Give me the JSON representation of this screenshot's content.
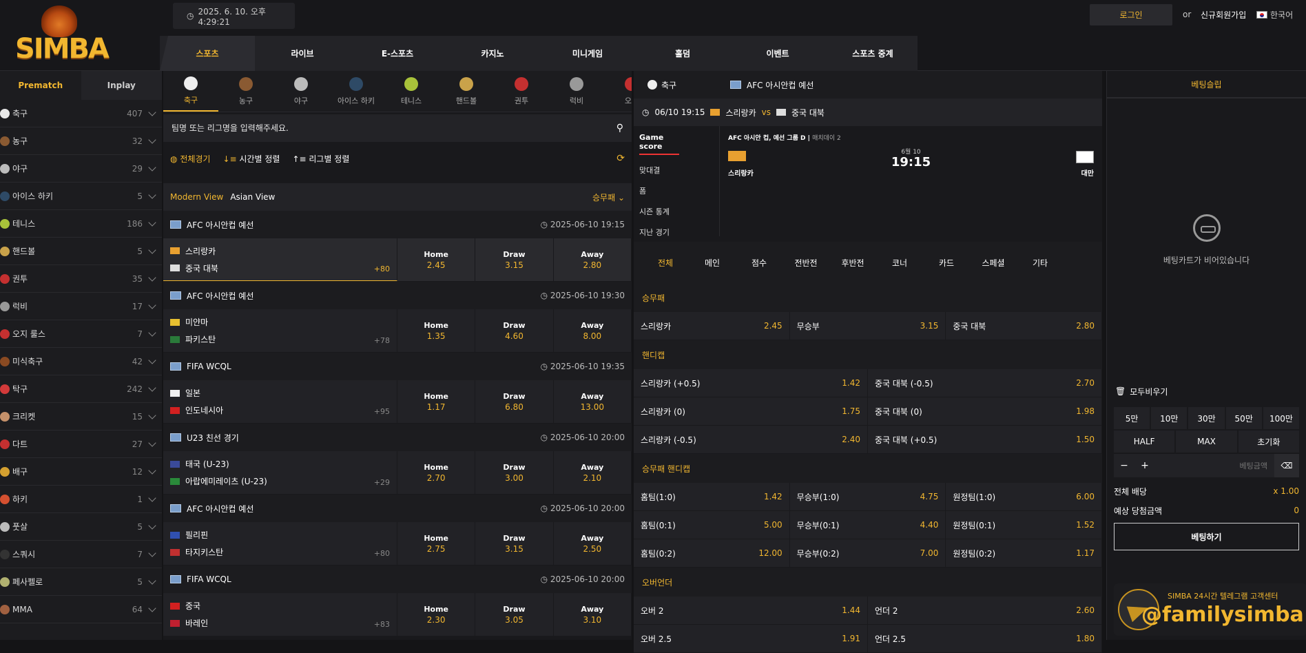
{
  "header": {
    "brand": "SIMBA",
    "datetime": "2025. 6. 10. 오후 4:29:21",
    "login": "로그인",
    "or": "or",
    "signup": "신규회원가입",
    "language": "한국어"
  },
  "nav": [
    {
      "label": "스포츠"
    },
    {
      "label": "라이브"
    },
    {
      "label": "E-스포츠"
    },
    {
      "label": "카지노"
    },
    {
      "label": "미니게임"
    },
    {
      "label": "홀덤"
    },
    {
      "label": "이벤트"
    },
    {
      "label": "스포츠 중계"
    }
  ],
  "sidebar": {
    "tabs": [
      {
        "label": "Prematch"
      },
      {
        "label": "Inplay"
      }
    ],
    "sports": [
      {
        "name": "축구",
        "count": "407",
        "color": "#e8e8e8"
      },
      {
        "name": "농구",
        "count": "32",
        "color": "#8a5a32"
      },
      {
        "name": "야구",
        "count": "29",
        "color": "#bbbbbb"
      },
      {
        "name": "아이스 하키",
        "count": "5",
        "color": "#2e4a66"
      },
      {
        "name": "테니스",
        "count": "186",
        "color": "#a8c23a"
      },
      {
        "name": "핸드볼",
        "count": "5",
        "color": "#c9a24a"
      },
      {
        "name": "권투",
        "count": "35",
        "color": "#c43030"
      },
      {
        "name": "럭비",
        "count": "17",
        "color": "#999999"
      },
      {
        "name": "오지 룰스",
        "count": "7",
        "color": "#c43030"
      },
      {
        "name": "미식축구",
        "count": "42",
        "color": "#8a4a22"
      },
      {
        "name": "탁구",
        "count": "242",
        "color": "#d23a3a"
      },
      {
        "name": "크리켓",
        "count": "15",
        "color": "#c4906a"
      },
      {
        "name": "다트",
        "count": "27",
        "color": "#c43030"
      },
      {
        "name": "배구",
        "count": "12",
        "color": "#d4a030"
      },
      {
        "name": "하키",
        "count": "1",
        "color": "#d45030"
      },
      {
        "name": "풋살",
        "count": "5",
        "color": "#bbbbbb"
      },
      {
        "name": "스쿼시",
        "count": "7",
        "color": "#333333"
      },
      {
        "name": "페사펠로",
        "count": "5",
        "color": "#b0b070"
      },
      {
        "name": "MMA",
        "count": "64",
        "color": "#a06040"
      }
    ]
  },
  "center": {
    "sport_tabs": [
      {
        "label": "축구",
        "color": "#eeeeee"
      },
      {
        "label": "농구",
        "color": "#8a5a32"
      },
      {
        "label": "야구",
        "color": "#bbbbbb"
      },
      {
        "label": "아이스 하키",
        "color": "#2e4a66"
      },
      {
        "label": "테니스",
        "color": "#a8c23a"
      },
      {
        "label": "핸드볼",
        "color": "#c9a24a"
      },
      {
        "label": "권투",
        "color": "#c43030"
      },
      {
        "label": "럭비",
        "color": "#999999"
      },
      {
        "label": "오지",
        "color": "#c43030"
      }
    ],
    "search_placeholder": "팀명 또는 리그명을 입력해주세요.",
    "filters": {
      "all": "전체경기",
      "by_time": "시간별 정렬",
      "by_league": "리그별 정렬"
    },
    "view": {
      "modern": "Modern View",
      "asian": "Asian View",
      "market": "승무패"
    },
    "leagues": [
      {
        "league": "AFC 아시안컵 예선",
        "date": "2025-06-10 19:15",
        "home": "스리랑카",
        "away": "중국 대북",
        "more": "+80",
        "home_flag": "#e8a030",
        "away_flag": "#dddddd",
        "odds": [
          {
            "label": "Home",
            "value": "2.45"
          },
          {
            "label": "Draw",
            "value": "3.15"
          },
          {
            "label": "Away",
            "value": "2.80"
          }
        ]
      },
      {
        "league": "AFC 아시안컵 예선",
        "date": "2025-06-10 19:30",
        "home": "미얀마",
        "away": "파키스탄",
        "more": "+78",
        "home_flag": "#e8c030",
        "away_flag": "#2a7a3a",
        "odds": [
          {
            "label": "Home",
            "value": "1.35"
          },
          {
            "label": "Draw",
            "value": "4.60"
          },
          {
            "label": "Away",
            "value": "8.00"
          }
        ]
      },
      {
        "league": "FIFA WCQL",
        "date": "2025-06-10 19:35",
        "home": "일본",
        "away": "인도네시아",
        "more": "+95",
        "home_flag": "#f0f0f0",
        "away_flag": "#d22020",
        "odds": [
          {
            "label": "Home",
            "value": "1.17"
          },
          {
            "label": "Draw",
            "value": "6.80"
          },
          {
            "label": "Away",
            "value": "13.00"
          }
        ]
      },
      {
        "league": "U23 친선 경기",
        "date": "2025-06-10 20:00",
        "home": "태국 (U-23)",
        "away": "아랍에미레이츠 (U-23)",
        "more": "+29",
        "home_flag": "#3a4a9a",
        "away_flag": "#2a8a3a",
        "odds": [
          {
            "label": "Home",
            "value": "2.70"
          },
          {
            "label": "Draw",
            "value": "3.00"
          },
          {
            "label": "Away",
            "value": "2.10"
          }
        ]
      },
      {
        "league": "AFC 아시안컵 예선",
        "date": "2025-06-10 20:00",
        "home": "필리핀",
        "away": "타지키스탄",
        "more": "+80",
        "home_flag": "#3050b0",
        "away_flag": "#c03030",
        "odds": [
          {
            "label": "Home",
            "value": "2.75"
          },
          {
            "label": "Draw",
            "value": "3.15"
          },
          {
            "label": "Away",
            "value": "2.50"
          }
        ]
      },
      {
        "league": "FIFA WCQL",
        "date": "2025-06-10 20:00",
        "home": "중국",
        "away": "바레인",
        "more": "+83",
        "home_flag": "#d22020",
        "away_flag": "#c02030",
        "odds": [
          {
            "label": "Home",
            "value": "2.30"
          },
          {
            "label": "Draw",
            "value": "3.05"
          },
          {
            "label": "Away",
            "value": "3.10"
          }
        ]
      }
    ]
  },
  "detail": {
    "sport": "축구",
    "league": "AFC 아시안컵 예선",
    "match_time": "06/10 19:15",
    "home": "스리랑카",
    "vs": "vs",
    "away": "중국 대북",
    "score_menu": [
      "Game score",
      "맞대결",
      "폼",
      "시즌 통계",
      "지난 경기"
    ],
    "score_league": "AFC 아시안 컵, 예선 그룹 D",
    "score_round": "매치데이 2",
    "score_date": "6월 10",
    "score_time": "19:15",
    "score_home": "스리랑카",
    "score_away": "대만",
    "bet_tabs": [
      "전체",
      "메인",
      "점수",
      "전반전",
      "후반전",
      "코너",
      "카드",
      "스페셜",
      "기타"
    ],
    "sections": [
      {
        "title": "승무패",
        "rows": [
          [
            {
              "name": "스리랑카",
              "value": "2.45"
            },
            {
              "name": "무승부",
              "value": "3.15"
            },
            {
              "name": "중국 대북",
              "value": "2.80"
            }
          ]
        ]
      },
      {
        "title": "핸디캡",
        "rows": [
          [
            {
              "name": "스리랑카 (+0.5)",
              "value": "1.42"
            },
            {
              "name": "중국 대북 (-0.5)",
              "value": "2.70"
            }
          ],
          [
            {
              "name": "스리랑카 (0)",
              "value": "1.75"
            },
            {
              "name": "중국 대북 (0)",
              "value": "1.98"
            }
          ],
          [
            {
              "name": "스리랑카 (-0.5)",
              "value": "2.40"
            },
            {
              "name": "중국 대북 (+0.5)",
              "value": "1.50"
            }
          ]
        ]
      },
      {
        "title": "승무패 핸디캡",
        "rows": [
          [
            {
              "name": "홈팀(1:0)",
              "value": "1.42"
            },
            {
              "name": "무승부(1:0)",
              "value": "4.75"
            },
            {
              "name": "원정팀(1:0)",
              "value": "6.00"
            }
          ],
          [
            {
              "name": "홈팀(0:1)",
              "value": "5.00"
            },
            {
              "name": "무승부(0:1)",
              "value": "4.40"
            },
            {
              "name": "원정팀(0:1)",
              "value": "1.52"
            }
          ],
          [
            {
              "name": "홈팀(0:2)",
              "value": "12.00"
            },
            {
              "name": "무승부(0:2)",
              "value": "7.00"
            },
            {
              "name": "원정팀(0:2)",
              "value": "1.17"
            }
          ]
        ]
      },
      {
        "title": "오버언더",
        "rows": [
          [
            {
              "name": "오버 2",
              "value": "1.44"
            },
            {
              "name": "언더 2",
              "value": "2.60"
            }
          ],
          [
            {
              "name": "오버 2.5",
              "value": "1.91"
            },
            {
              "name": "언더 2.5",
              "value": "1.80"
            }
          ]
        ]
      }
    ]
  },
  "slip": {
    "title": "베팅슬립",
    "empty": "베팅카트가 비어있습니다",
    "clear_all": "모두비우기",
    "amounts": [
      "5만",
      "10만",
      "30만",
      "50만",
      "100만"
    ],
    "actions": [
      "HALF",
      "MAX",
      "초기화"
    ],
    "minus": "−",
    "plus": "+",
    "amount_label": "베팅금액",
    "total_odds_label": "전체 배당",
    "total_odds_value": "x 1.00",
    "expected_label": "예상 당첨금액",
    "expected_value": "0",
    "bet_button": "베팅하기",
    "telegram_title": "SIMBA 24시간 텔레그램 고객센터",
    "telegram_handle": "@familysimba"
  },
  "colors": {
    "accent": "#f2b730",
    "background": "#141416",
    "panel": "#222226"
  }
}
